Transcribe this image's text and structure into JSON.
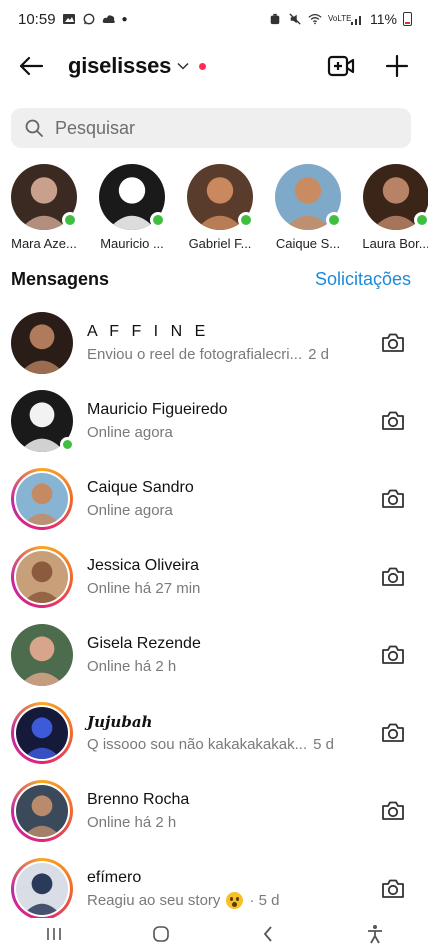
{
  "status_bar": {
    "time": "10:59",
    "network": "VoLTE",
    "battery": "11%"
  },
  "header": {
    "username": "giselisses",
    "back_icon": "arrow-left-icon",
    "video_icon": "video-call-icon",
    "new_icon": "plus-icon"
  },
  "search": {
    "placeholder": "Pesquisar"
  },
  "stories": [
    {
      "label": "Mara Aze...",
      "online": true,
      "colors": [
        "#3a2a22",
        "#c9a08c"
      ]
    },
    {
      "label": "Mauricio ...",
      "online": true,
      "colors": [
        "#1a1a1a",
        "#ffffff"
      ]
    },
    {
      "label": "Gabriel F...",
      "online": true,
      "colors": [
        "#5a3c2c",
        "#c9885d"
      ]
    },
    {
      "label": "Caique S...",
      "online": true,
      "colors": [
        "#7fa9c9",
        "#c98b62"
      ]
    },
    {
      "label": "Laura Bor...",
      "online": true,
      "colors": [
        "#3b2418",
        "#b88266"
      ]
    }
  ],
  "section": {
    "title": "Mensagens",
    "requests": "Solicitações"
  },
  "messages": [
    {
      "name": "A F F I N E",
      "sub": "Enviou o reel de fotografialecri...",
      "time": "2 d",
      "online": false,
      "ring": false
    },
    {
      "name": "Mauricio Figueiredo",
      "sub": "Online agora",
      "time": "",
      "online": true,
      "ring": false
    },
    {
      "name": "Caique Sandro",
      "sub": "Online agora",
      "time": "",
      "online": false,
      "ring": true
    },
    {
      "name": "Jessica Oliveira",
      "sub": "Online há 27 min",
      "time": "",
      "online": false,
      "ring": true
    },
    {
      "name": "Gisela Rezende",
      "sub": "Online há 2 h",
      "time": "",
      "online": false,
      "ring": false
    },
    {
      "name": "Jujubah",
      "sub": "Q issooo sou não kakakakakak...",
      "time": "5 d",
      "online": false,
      "ring": true
    },
    {
      "name": "Brenno Rocha",
      "sub": "Online há 2 h",
      "time": "",
      "online": false,
      "ring": true
    },
    {
      "name": "efímero",
      "sub": "Reagiu ao seu story",
      "time": "· 5 d",
      "online": false,
      "ring": true
    }
  ],
  "nav": {
    "recents_icon": "recents-icon",
    "home_icon": "home-icon",
    "back_icon": "back-chevron-icon",
    "accessibility_icon": "accessibility-icon"
  }
}
